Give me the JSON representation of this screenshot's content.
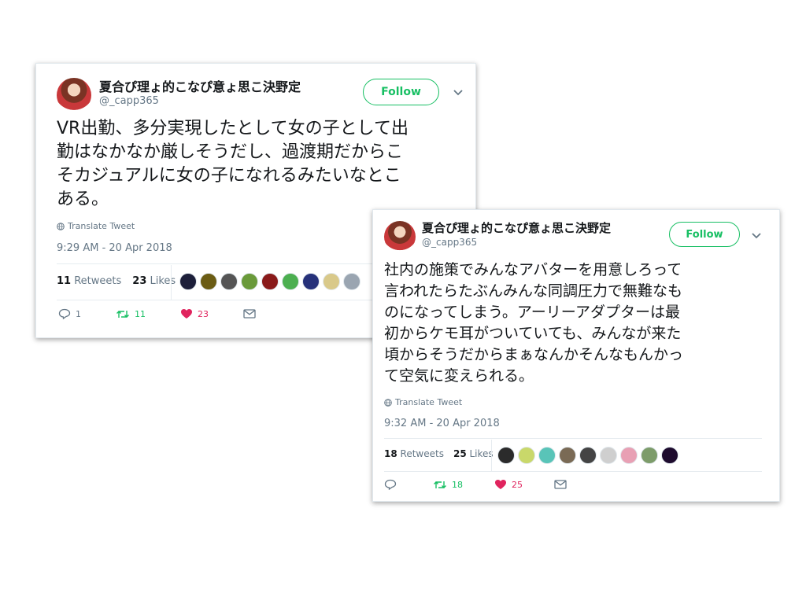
{
  "tweets": [
    {
      "display_name": "夏合ぴ理ょ的こなぴ意ょ思こ決野定",
      "handle": "@_capp365",
      "follow_label": "Follow",
      "text": "VR出勤、多分実現したとして女の子として出\n勤はなかなか厳しそうだし、過渡期だからこ\nそカジュアルに女の子になれるみたいなとこ\nある。",
      "translate_label": "Translate Tweet",
      "timestamp": "9:29 AM - 20 Apr 2018",
      "retweets_count": "11",
      "retweets_label": "Retweets",
      "likes_count": "23",
      "likes_label": "Likes",
      "liker_colors": [
        "#1d1f3a",
        "#6b5c14",
        "#555555",
        "#6a9a3a",
        "#8a1a1a",
        "#4caf50",
        "#26317a",
        "#d9c98a",
        "#9aa5b1"
      ],
      "actions": {
        "replies": "1",
        "retweets": "11",
        "likes": "23"
      }
    },
    {
      "display_name": "夏合ぴ理ょ的こなぴ意ょ思こ決野定",
      "handle": "@_capp365",
      "follow_label": "Follow",
      "text": "社内の施策でみんなアバターを用意しろって\n言われたらたぶんみんな同調圧力で無難なも\nのになってしまう。アーリーアダプターは最\n初からケモ耳がついていても、みんなが来た\n頃からそうだからまぁなんかそんなもんかっ\nて空気に変えられる。",
      "translate_label": "Translate Tweet",
      "timestamp": "9:32 AM - 20 Apr 2018",
      "retweets_count": "18",
      "retweets_label": "Retweets",
      "likes_count": "25",
      "likes_label": "Likes",
      "liker_colors": [
        "#2b2b2b",
        "#c9d86a",
        "#59c4b8",
        "#7a6a55",
        "#444444",
        "#cfcfcf",
        "#e8a0b4",
        "#7d9c6a",
        "#1e0b2e"
      ],
      "actions": {
        "replies": "",
        "retweets": "18",
        "likes": "25"
      }
    }
  ],
  "colors": {
    "accent_green": "#17bf63",
    "like_red": "#e0245e",
    "muted": "#657786"
  },
  "icons": [
    "caret-down-icon",
    "globe-icon",
    "reply-icon",
    "retweet-icon",
    "heart-icon",
    "mail-icon"
  ]
}
